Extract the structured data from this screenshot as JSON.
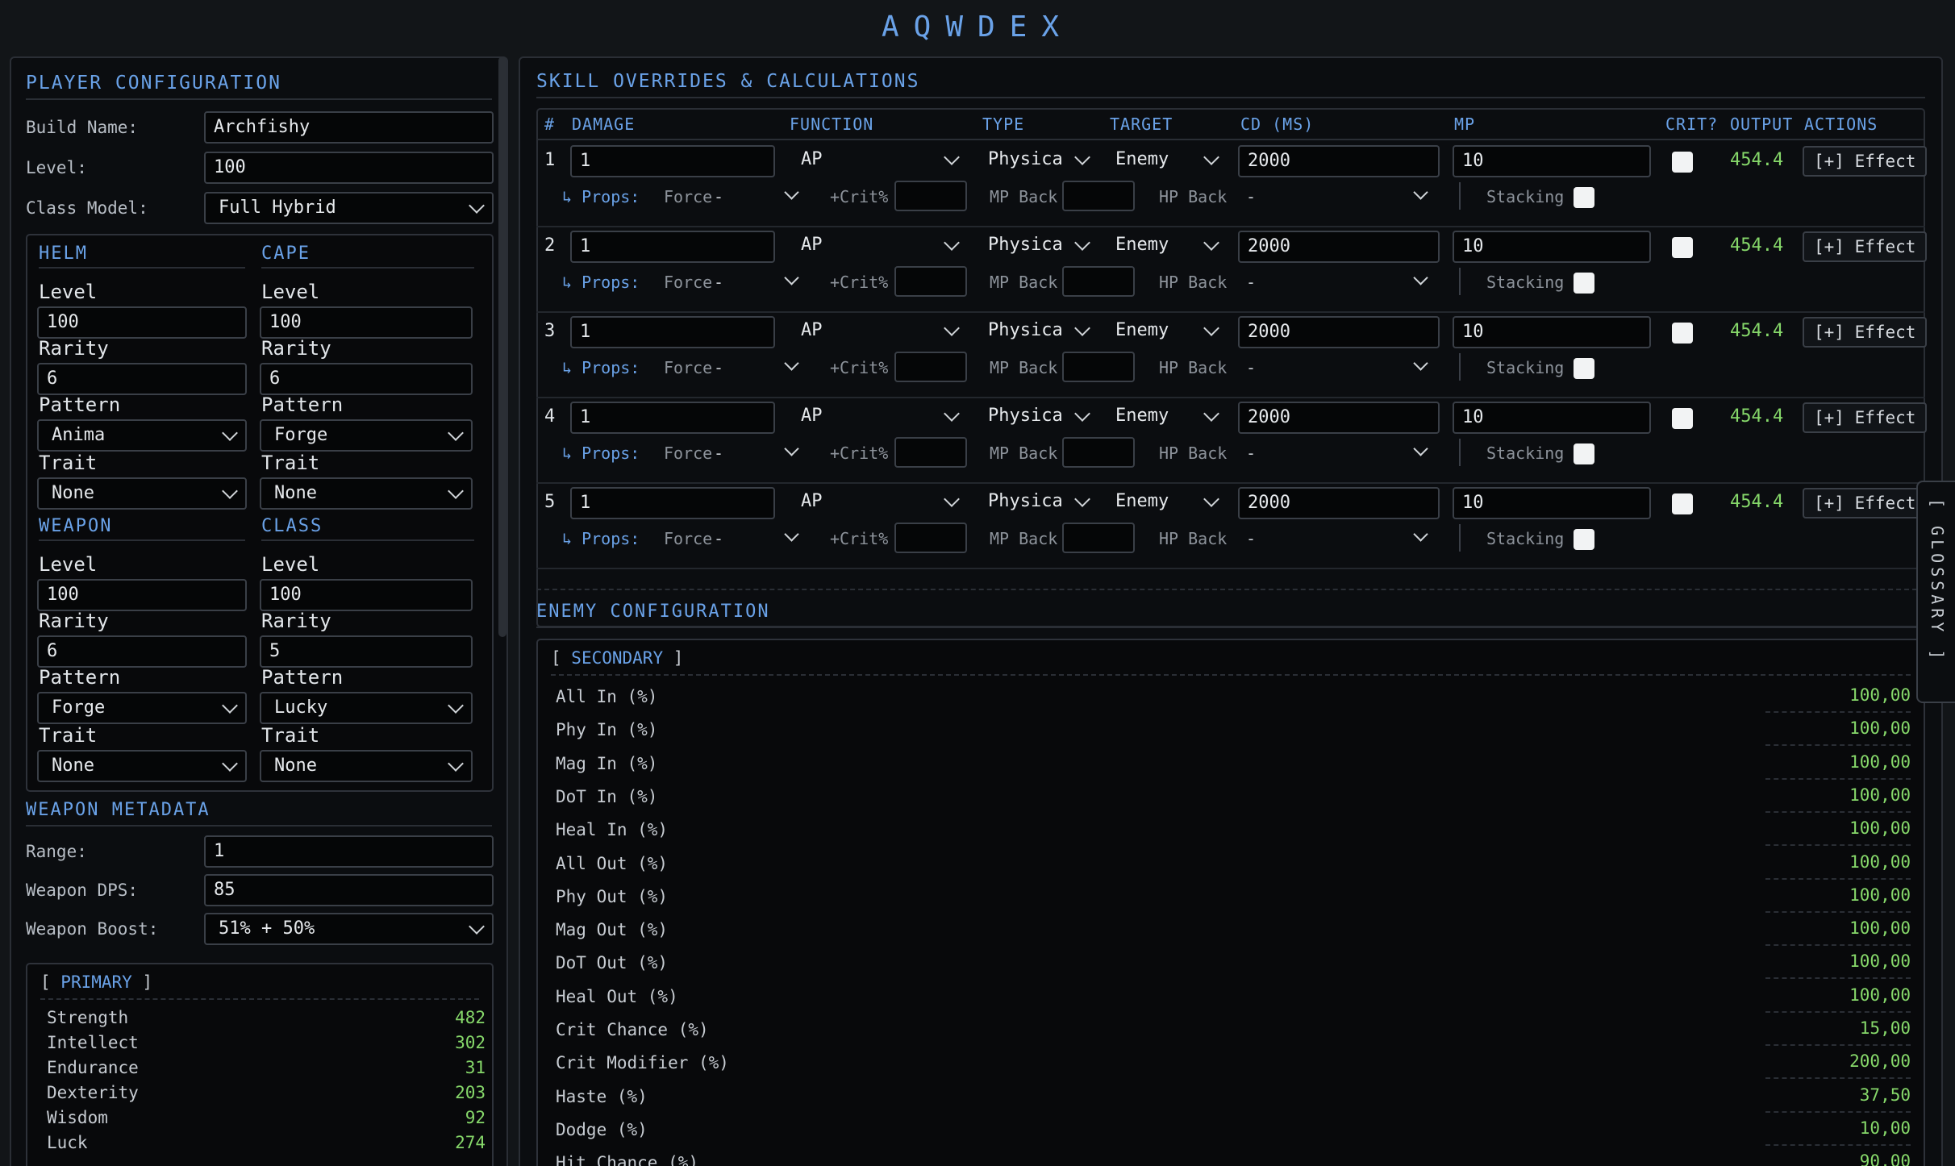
{
  "app_title": "AQWDEX",
  "player": {
    "title": "PLAYER CONFIGURATION",
    "build_name_label": "Build Name:",
    "build_name": "Archfishy",
    "level_label": "Level:",
    "level": "100",
    "class_model_label": "Class Model:",
    "class_model": "Full Hybrid",
    "field_labels": {
      "level": "Level",
      "rarity": "Rarity",
      "pattern": "Pattern",
      "trait": "Trait"
    },
    "gear": [
      {
        "name": "HELM",
        "level": "100",
        "rarity": "6",
        "pattern": "Anima",
        "trait": "None"
      },
      {
        "name": "CAPE",
        "level": "100",
        "rarity": "6",
        "pattern": "Forge",
        "trait": "None"
      },
      {
        "name": "WEAPON",
        "level": "100",
        "rarity": "6",
        "pattern": "Forge",
        "trait": "None"
      },
      {
        "name": "CLASS",
        "level": "100",
        "rarity": "5",
        "pattern": "Lucky",
        "trait": "None"
      }
    ]
  },
  "weapon_meta": {
    "title": "WEAPON METADATA",
    "range_label": "Range:",
    "range": "1",
    "dps_label": "Weapon DPS:",
    "dps": "85",
    "boost_label": "Weapon Boost:",
    "boost": "51% + 50%"
  },
  "primary": {
    "title": "PRIMARY",
    "stats": [
      {
        "name": "Strength",
        "value": "482"
      },
      {
        "name": "Intellect",
        "value": "302"
      },
      {
        "name": "Endurance",
        "value": "31"
      },
      {
        "name": "Dexterity",
        "value": "203"
      },
      {
        "name": "Wisdom",
        "value": "92"
      },
      {
        "name": "Luck",
        "value": "274"
      }
    ]
  },
  "skills": {
    "title": "SKILL OVERRIDES & CALCULATIONS",
    "headers": {
      "num": "#",
      "damage": "DAMAGE",
      "function": "FUNCTION",
      "type": "TYPE",
      "target": "TARGET",
      "cd": "CD (MS)",
      "mp": "MP",
      "crit": "CRIT?",
      "output": "OUTPUT",
      "actions": "ACTIONS"
    },
    "props_labels": {
      "props": "↳ Props:",
      "force": "Force",
      "crit_pct": "+Crit%",
      "mp_back": "MP Back",
      "hp_back": "HP Back",
      "stacking": "Stacking"
    },
    "effect_label": "[+] Effect",
    "rows": [
      {
        "num": "1",
        "damage": "1",
        "function": "AP",
        "type": "Physica",
        "target": "Enemy",
        "cd": "2000",
        "mp": "10",
        "output": "454.4",
        "force": "-",
        "hp_back": "-"
      },
      {
        "num": "2",
        "damage": "1",
        "function": "AP",
        "type": "Physica",
        "target": "Enemy",
        "cd": "2000",
        "mp": "10",
        "output": "454.4",
        "force": "-",
        "hp_back": "-"
      },
      {
        "num": "3",
        "damage": "1",
        "function": "AP",
        "type": "Physica",
        "target": "Enemy",
        "cd": "2000",
        "mp": "10",
        "output": "454.4",
        "force": "-",
        "hp_back": "-"
      },
      {
        "num": "4",
        "damage": "1",
        "function": "AP",
        "type": "Physica",
        "target": "Enemy",
        "cd": "2000",
        "mp": "10",
        "output": "454.4",
        "force": "-",
        "hp_back": "-"
      },
      {
        "num": "5",
        "damage": "1",
        "function": "AP",
        "type": "Physica",
        "target": "Enemy",
        "cd": "2000",
        "mp": "10",
        "output": "454.4",
        "force": "-",
        "hp_back": "-"
      }
    ]
  },
  "enemy": {
    "title": "ENEMY CONFIGURATION",
    "secondary_title": "SECONDARY",
    "stats": [
      {
        "name": "All In (%)",
        "value": "100,00"
      },
      {
        "name": "Phy In (%)",
        "value": "100,00"
      },
      {
        "name": "Mag In (%)",
        "value": "100,00"
      },
      {
        "name": "DoT In (%)",
        "value": "100,00"
      },
      {
        "name": "Heal In (%)",
        "value": "100,00"
      },
      {
        "name": "All Out (%)",
        "value": "100,00"
      },
      {
        "name": "Phy Out (%)",
        "value": "100,00"
      },
      {
        "name": "Mag Out (%)",
        "value": "100,00"
      },
      {
        "name": "DoT Out (%)",
        "value": "100,00"
      },
      {
        "name": "Heal Out (%)",
        "value": "100,00"
      },
      {
        "name": "Crit Chance (%)",
        "value": "15,00"
      },
      {
        "name": "Crit Modifier (%)",
        "value": "200,00"
      },
      {
        "name": "Haste (%)",
        "value": "37,50"
      },
      {
        "name": "Dodge (%)",
        "value": "10,00"
      },
      {
        "name": "Hit Chance (%)",
        "value": "90,00"
      }
    ]
  },
  "glossary": "[ GLOSSARY ]",
  "colors": {
    "accent": "#6aa2e8",
    "positive": "#86d86a",
    "background": "#121518"
  }
}
